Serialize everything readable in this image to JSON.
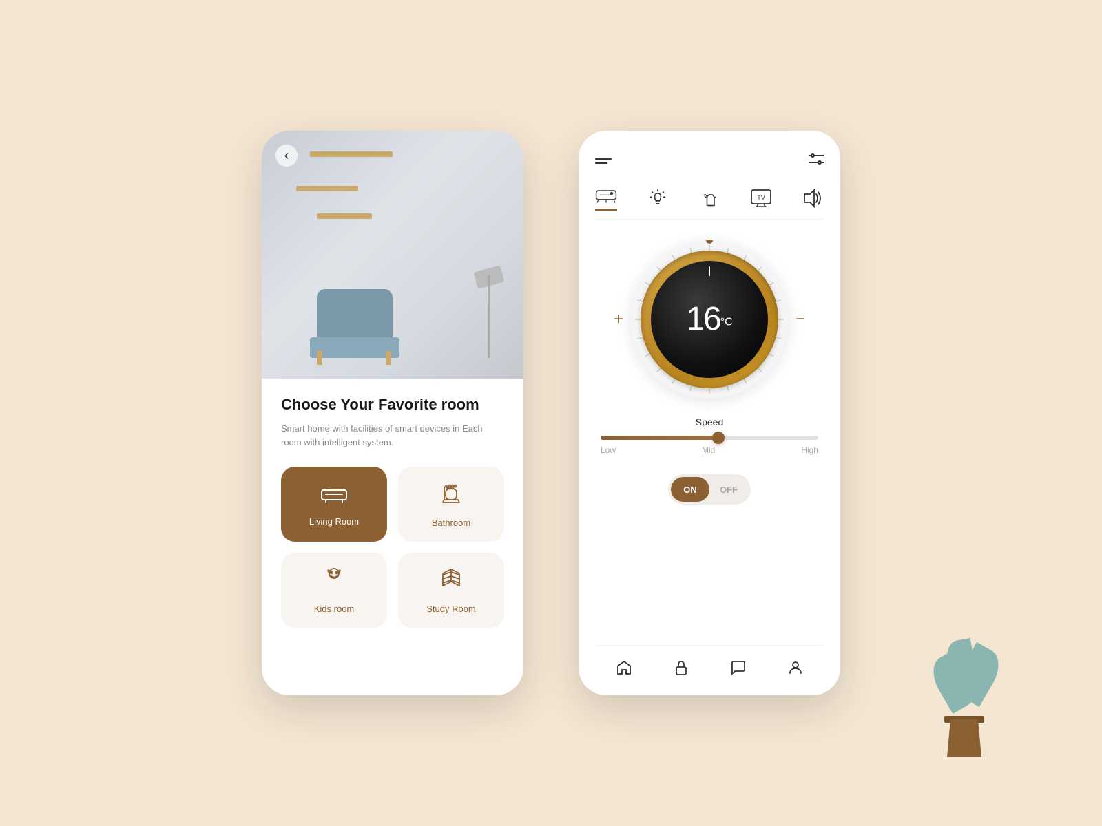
{
  "background_color": "#f5e6d3",
  "left_phone": {
    "back_button": "‹",
    "title": "Choose Your Favorite room",
    "subtitle": "Smart home with facilities of smart devices in Each room with intelligent system.",
    "rooms": [
      {
        "id": "living-room",
        "label": "Living Room",
        "icon": "sofa",
        "active": true
      },
      {
        "id": "bathroom",
        "label": "Bathroom",
        "icon": "bath",
        "active": false
      },
      {
        "id": "kids-room",
        "label": "Kids room",
        "icon": "kids",
        "active": false
      },
      {
        "id": "study-room",
        "label": "Study Room",
        "icon": "book",
        "active": false
      }
    ]
  },
  "right_phone": {
    "header": {
      "menu_icon": "hamburger",
      "filter_icon": "sliders"
    },
    "device_tabs": [
      {
        "id": "ac",
        "label": "AC",
        "active": true
      },
      {
        "id": "light",
        "label": "Light",
        "active": false
      },
      {
        "id": "plant",
        "label": "Plant",
        "active": false
      },
      {
        "id": "tv",
        "label": "TV",
        "active": false
      },
      {
        "id": "speaker",
        "label": "Speaker",
        "active": false
      }
    ],
    "thermostat": {
      "temperature": "16",
      "unit": "°C",
      "decrease_btn": "−",
      "increase_btn": "+"
    },
    "speed": {
      "label": "Speed",
      "levels": [
        "Low",
        "Mid",
        "High"
      ],
      "current_level": "Mid"
    },
    "power": {
      "on_label": "ON",
      "off_label": "OFF",
      "state": "on"
    },
    "bottom_nav": [
      {
        "id": "home",
        "icon": "home"
      },
      {
        "id": "lock",
        "icon": "lock"
      },
      {
        "id": "chat",
        "icon": "chat"
      },
      {
        "id": "profile",
        "icon": "person"
      }
    ]
  },
  "plant_decoration": {
    "visible": true
  }
}
